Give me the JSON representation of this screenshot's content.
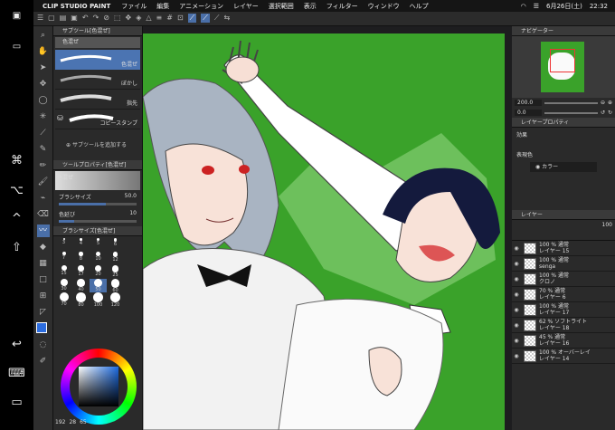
{
  "menubar": {
    "apple": "",
    "app": "CLIP STUDIO PAINT",
    "items": [
      "ファイル",
      "編集",
      "アニメーション",
      "レイヤー",
      "選択範囲",
      "表示",
      "フィルター",
      "ウィンドウ",
      "ヘルプ"
    ],
    "date": "6月26日(土)",
    "time": "22:32"
  },
  "sidebar": [
    "⌘",
    "⌥",
    "^",
    "⇧",
    "↩",
    "⌨",
    "▭"
  ],
  "subtool": {
    "header": "サブツール[色混ぜ]",
    "tab": "色混ぜ",
    "items": [
      "色混ぜ",
      "ぼかし",
      "指先",
      "コピースタンプ"
    ],
    "add_label": "サブツールを追加する"
  },
  "toolprop": {
    "header": "ツールプロパティ[色混ぜ]",
    "name": "色混ぜ",
    "brush_size_label": "ブラシサイズ",
    "brush_size_value": "50.0",
    "color_stretch_label": "色延び",
    "color_stretch_value": "10"
  },
  "brushsize": {
    "header": "ブラシサイズ[色混ぜ]",
    "values": [
      "3",
      "4",
      "5",
      "6",
      "7",
      "8",
      "10",
      "12",
      "15",
      "17",
      "20",
      "25",
      "30",
      "40",
      "50",
      "60",
      "70",
      "80",
      "100",
      "120"
    ]
  },
  "colorwheel": {
    "status": [
      "192",
      "28",
      "65"
    ]
  },
  "navigator": {
    "header": "ナビゲーター",
    "zoom": "200.0",
    "angle": "0.0"
  },
  "layerprop": {
    "header": "レイヤープロパティ",
    "effect_label": "効果",
    "expression_label": "表現色",
    "color_mode": "カラー"
  },
  "layers": {
    "header": "レイヤー",
    "opacity": "100",
    "rows": [
      {
        "top": "100 % 通常",
        "name": "レイヤー 15"
      },
      {
        "top": "100 % 通常",
        "name": "senga"
      },
      {
        "top": "100 % 通常",
        "name": "クロノ"
      },
      {
        "top": "70 % 通常",
        "name": "レイヤー 6"
      },
      {
        "top": "100 % 通常",
        "name": "レイヤー 17"
      },
      {
        "top": "62 % ソフトライト",
        "name": "レイヤー 18"
      },
      {
        "top": "45 % 通常",
        "name": "レイヤー 16"
      },
      {
        "top": "100 % オーバーレイ",
        "name": "レイヤー 14"
      }
    ]
  },
  "colors": {
    "canvas_bg": "#3aa22a",
    "accent": "#4a6fa8"
  }
}
